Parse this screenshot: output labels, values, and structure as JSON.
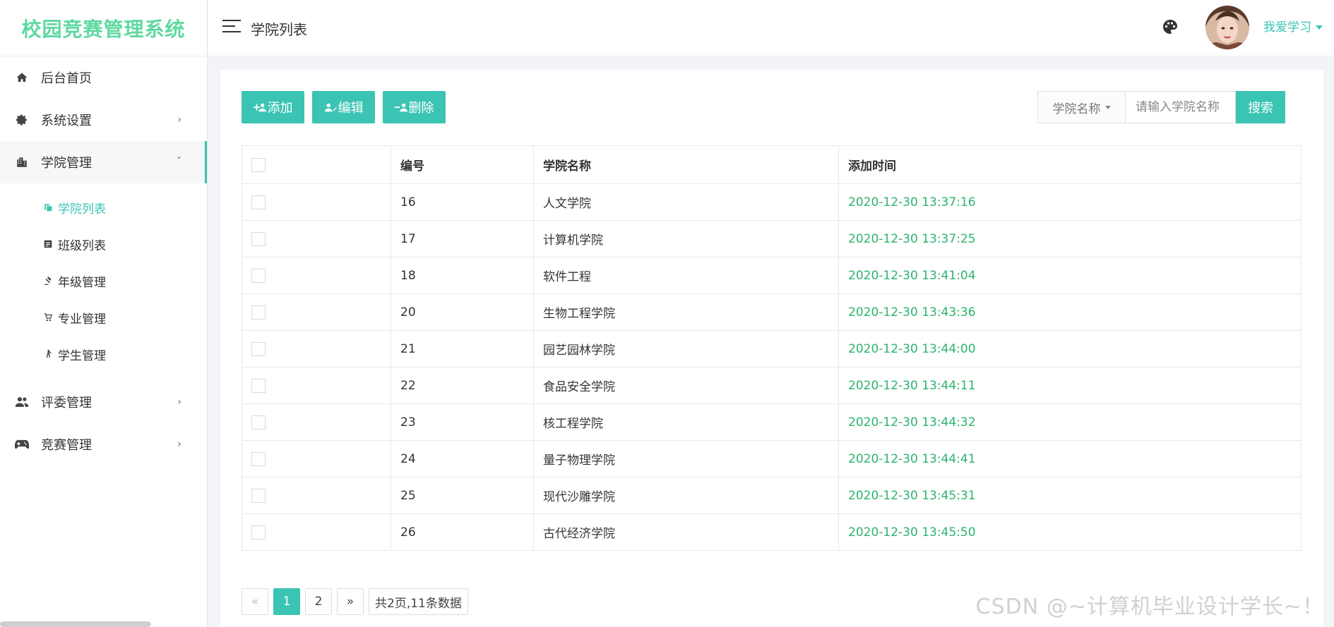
{
  "app": {
    "title": "校园竞赛管理系统"
  },
  "header": {
    "title": "学院列表",
    "username": "我爱学习"
  },
  "sidebar": {
    "items": [
      {
        "label": "后台首页",
        "icon": "home-icon"
      },
      {
        "label": "系统设置",
        "icon": "gear-icon"
      },
      {
        "label": "学院管理",
        "icon": "building-icon"
      },
      {
        "label": "评委管理",
        "icon": "users-icon"
      },
      {
        "label": "竞赛管理",
        "icon": "gamepad-icon"
      }
    ],
    "sub_items": [
      {
        "label": "学院列表",
        "icon": "copy-icon",
        "active": true
      },
      {
        "label": "班级列表",
        "icon": "list-icon"
      },
      {
        "label": "年级管理",
        "icon": "gavel-icon"
      },
      {
        "label": "专业管理",
        "icon": "cart-icon"
      },
      {
        "label": "学生管理",
        "icon": "walk-icon"
      }
    ]
  },
  "toolbar": {
    "add_label": "添加",
    "edit_label": "编辑",
    "delete_label": "删除"
  },
  "search": {
    "field_label": "学院名称",
    "placeholder": "请输入学院名称",
    "button_label": "搜索"
  },
  "table": {
    "columns": [
      "编号",
      "学院名称",
      "添加时间"
    ],
    "rows": [
      {
        "id": "16",
        "name": "人文学院",
        "time": "2020-12-30 13:37:16"
      },
      {
        "id": "17",
        "name": "计算机学院",
        "time": "2020-12-30 13:37:25"
      },
      {
        "id": "18",
        "name": "软件工程",
        "time": "2020-12-30 13:41:04"
      },
      {
        "id": "20",
        "name": "生物工程学院",
        "time": "2020-12-30 13:43:36"
      },
      {
        "id": "21",
        "name": "园艺园林学院",
        "time": "2020-12-30 13:44:00"
      },
      {
        "id": "22",
        "name": "食品安全学院",
        "time": "2020-12-30 13:44:11"
      },
      {
        "id": "23",
        "name": "核工程学院",
        "time": "2020-12-30 13:44:32"
      },
      {
        "id": "24",
        "name": "量子物理学院",
        "time": "2020-12-30 13:44:41"
      },
      {
        "id": "25",
        "name": "现代沙雕学院",
        "time": "2020-12-30 13:45:31"
      },
      {
        "id": "26",
        "name": "古代经济学院",
        "time": "2020-12-30 13:45:50"
      }
    ]
  },
  "pager": {
    "prev": "«",
    "pages": [
      "1",
      "2"
    ],
    "next": "»",
    "info": "共2页,11条数据"
  },
  "watermark": "CSDN @~计算机毕业设计学长~！",
  "colors": {
    "accent": "#3bc4b3",
    "logo": "#5ed9a0",
    "time": "#2bb36e"
  }
}
